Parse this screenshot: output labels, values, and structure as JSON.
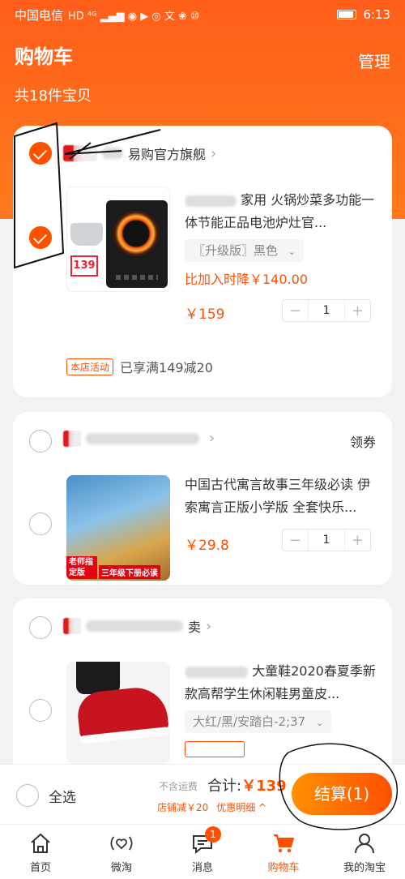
{
  "status_bar": {
    "carrier": "中国电信",
    "indicators": "HD ⁴ᴳ ▂▄▆ ◉ ▶ ◎ 文 ❀ ⑩",
    "time": "6:13"
  },
  "header": {
    "title": "购物车",
    "manage": "管理",
    "count": "共18件宝贝"
  },
  "shops": [
    {
      "name": "易购官方旗舰",
      "checked": true,
      "item": {
        "title": "家用 火锅炒菜多功能一体节能正品电池炉灶官...",
        "sku": "〖升级版〗黑色",
        "note": "比加入时降￥140.00",
        "price": "￥159",
        "qty": "1",
        "thumb_price": "139",
        "checked": true
      },
      "promo_badge": "本店活动",
      "promo_text": "已享满149减20"
    },
    {
      "name": "",
      "coupon": "领券",
      "checked": false,
      "item": {
        "title": "中国古代寓言故事三年级必读 伊索寓言正版小学版 全套快乐...",
        "price": "￥29.8",
        "qty": "1",
        "thumb_label_1": "老师指定版",
        "thumb_label_2": "三年级下册必读",
        "checked": false
      }
    },
    {
      "name": "卖",
      "checked": false,
      "item": {
        "title": "大童鞋2020春夏季新款高帮学生休闲鞋男童皮...",
        "sku": "大红/黑/安踏白-2;37",
        "checked": false
      }
    }
  ],
  "checkout": {
    "select_all": "全选",
    "no_shipping": "不含运费",
    "total_label": "合计:",
    "total_value": "￥139",
    "shop_discount": "店铺减￥20",
    "discount_detail": "优惠明细 ^",
    "button": "结算(1)"
  },
  "tabs": [
    {
      "label": "首页",
      "icon": "home-icon"
    },
    {
      "label": "微淘",
      "icon": "heart-signal-icon"
    },
    {
      "label": "消息",
      "icon": "message-icon",
      "badge": "1"
    },
    {
      "label": "购物车",
      "icon": "cart-icon",
      "active": true
    },
    {
      "label": "我的淘宝",
      "icon": "user-icon"
    }
  ],
  "colors": {
    "brand": "#ff5000",
    "header_gradient": "#ff6a1a"
  }
}
